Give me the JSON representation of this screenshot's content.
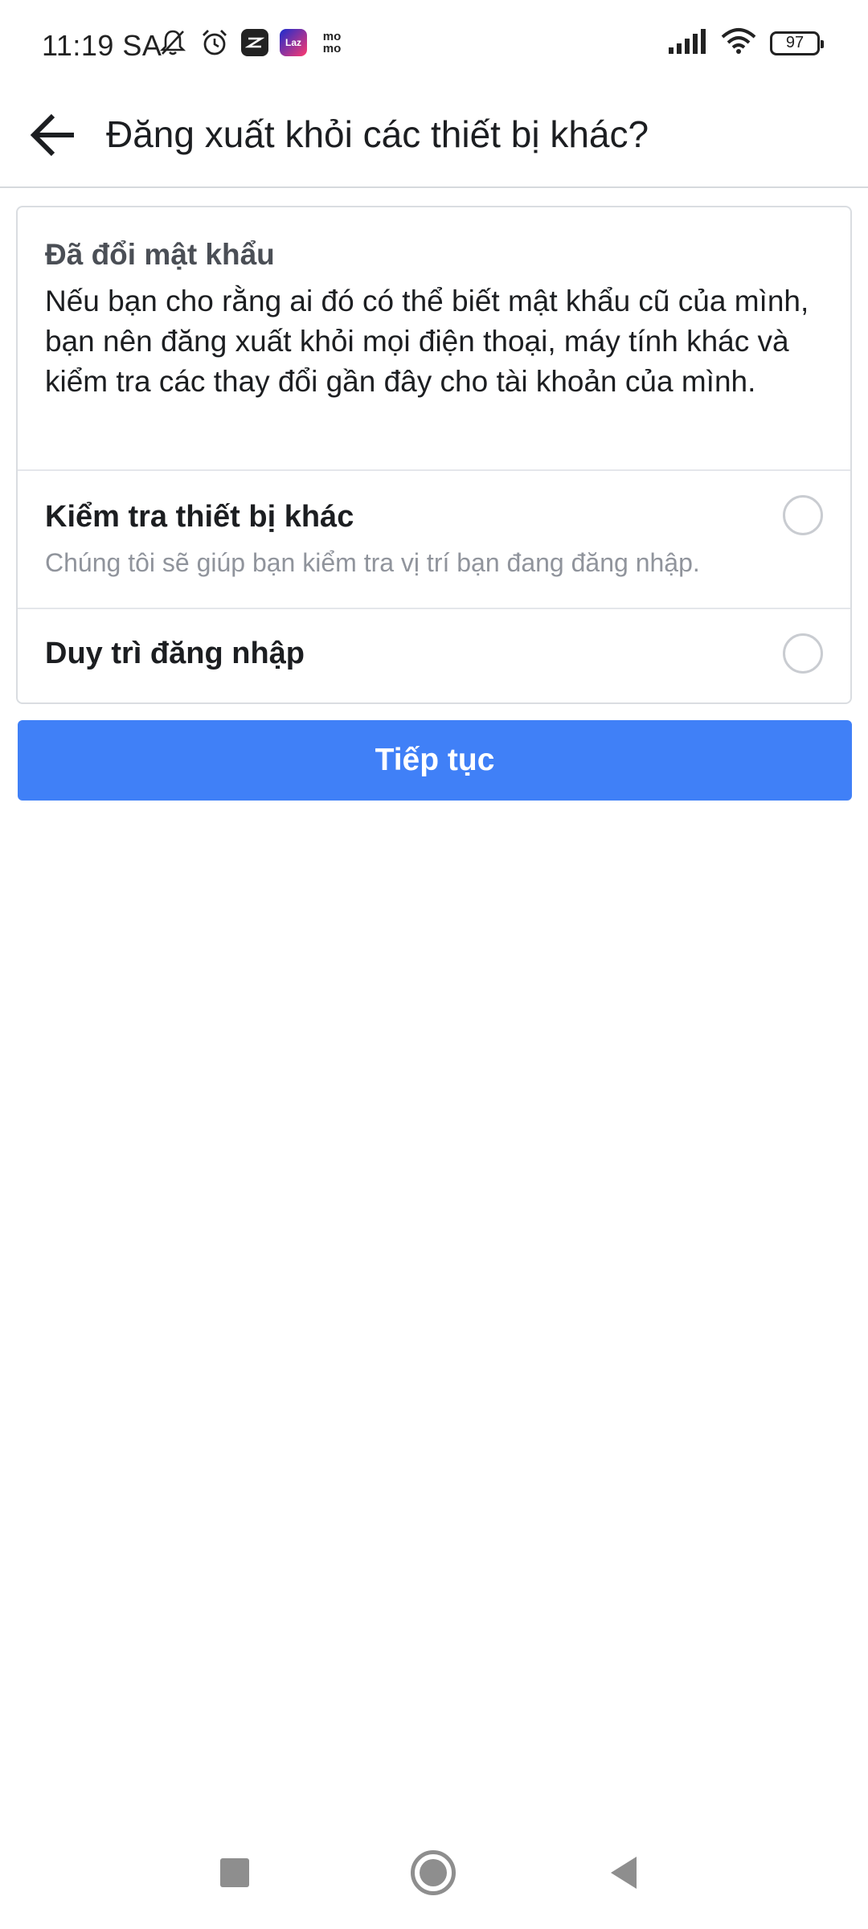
{
  "status_bar": {
    "time": "11:19 SA",
    "left_icons": [
      "bell-muted-icon",
      "alarm-clock-icon",
      "capcut-app-icon",
      "lazada-app-icon",
      "momo-app-icon"
    ],
    "lazada_label": "Laz",
    "momo_label_line1": "mo",
    "momo_label_line2": "mo",
    "right_icons": [
      "signal-icon",
      "wifi-icon",
      "battery-icon"
    ],
    "battery_level": "97"
  },
  "header": {
    "title": "Đăng xuất khỏi các thiết bị khác?"
  },
  "card": {
    "heading": "Đã đổi mật khẩu",
    "body": "Nếu bạn cho rằng ai đó có thể biết mật khẩu cũ của mình, bạn nên đăng xuất khỏi mọi điện thoại, máy tính khác và kiểm tra các thay đổi gần đây cho tài khoản của mình.",
    "options": [
      {
        "title": "Kiểm tra thiết bị khác",
        "description": "Chúng tôi sẽ giúp bạn kiểm tra vị trí bạn đang đăng nhập.",
        "selected": false
      },
      {
        "title": "Duy trì đăng nhập",
        "selected": false
      }
    ]
  },
  "continue_button": {
    "label": "Tiếp tục",
    "color": "#4080f7"
  },
  "nav_bar": {
    "icons": [
      "recent-apps-icon",
      "home-icon",
      "back-nav-icon"
    ]
  }
}
